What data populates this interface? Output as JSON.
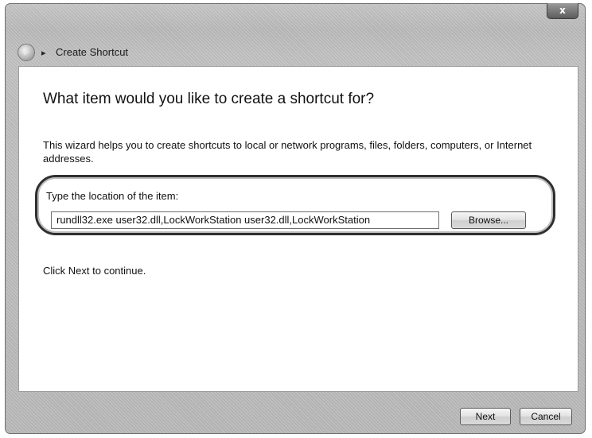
{
  "window": {
    "title": "Create Shortcut",
    "close_label": "x"
  },
  "main": {
    "heading": "What item would you like to create a shortcut for?",
    "description": "This wizard helps you to create shortcuts to local or network programs, files, folders, computers, or Internet addresses.",
    "location_label": "Type the location of the item:",
    "location_value": "rundll32.exe user32.dll,LockWorkStation user32.dll,LockWorkStation",
    "browse_label": "Browse...",
    "continue_text": "Click Next to continue."
  },
  "footer": {
    "next_label": "Next",
    "cancel_label": "Cancel"
  },
  "icons": {
    "back": "back-arrow-icon",
    "title": "shortcut-icon",
    "close": "close-icon"
  },
  "colors": {
    "frame": "#bdbdbd",
    "highlight_ring": "#2f2f2f"
  }
}
